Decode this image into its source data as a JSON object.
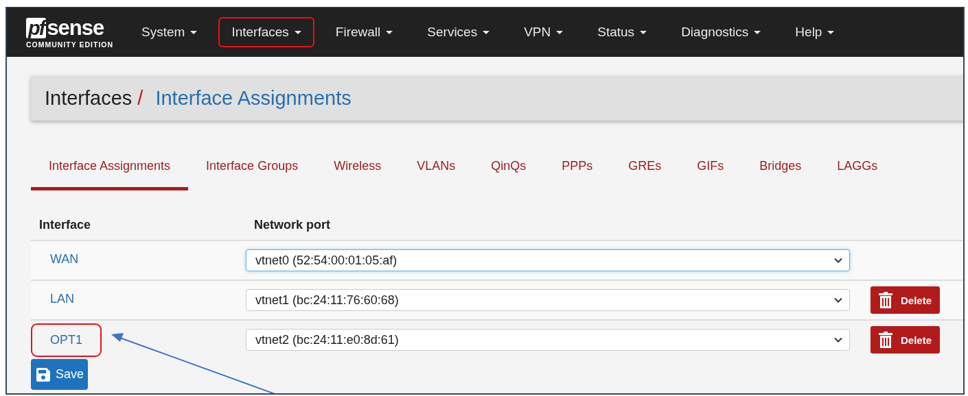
{
  "logo": {
    "mark": "pf",
    "name": "sense",
    "edition": "COMMUNITY EDITION"
  },
  "nav": [
    {
      "label": "System",
      "highlighted": false
    },
    {
      "label": "Interfaces",
      "highlighted": true
    },
    {
      "label": "Firewall",
      "highlighted": false
    },
    {
      "label": "Services",
      "highlighted": false
    },
    {
      "label": "VPN",
      "highlighted": false
    },
    {
      "label": "Status",
      "highlighted": false
    },
    {
      "label": "Diagnostics",
      "highlighted": false
    },
    {
      "label": "Help",
      "highlighted": false
    }
  ],
  "breadcrumb": {
    "parent": "Interfaces",
    "separator": "/",
    "current": "Interface Assignments"
  },
  "tabs": [
    {
      "label": "Interface Assignments",
      "selected": true
    },
    {
      "label": "Interface Groups",
      "selected": false
    },
    {
      "label": "Wireless",
      "selected": false
    },
    {
      "label": "VLANs",
      "selected": false
    },
    {
      "label": "QinQs",
      "selected": false
    },
    {
      "label": "PPPs",
      "selected": false
    },
    {
      "label": "GREs",
      "selected": false
    },
    {
      "label": "GIFs",
      "selected": false
    },
    {
      "label": "Bridges",
      "selected": false
    },
    {
      "label": "LAGGs",
      "selected": false
    }
  ],
  "table": {
    "columns": [
      "Interface",
      "Network port"
    ],
    "rows": [
      {
        "interface": "WAN",
        "port": "vtnet0 (52:54:00:01:05:af)",
        "focused": true,
        "highlighted": false
      },
      {
        "interface": "LAN",
        "port": "vtnet1 (bc:24:11:76:60:68)",
        "focused": false,
        "highlighted": false,
        "delete_button": "Delete"
      },
      {
        "interface": "OPT1",
        "port": "vtnet2 (bc:24:11:e0:8d:61)",
        "focused": false,
        "highlighted": true,
        "delete_button": "Delete"
      }
    ]
  },
  "save_button": "Save"
}
